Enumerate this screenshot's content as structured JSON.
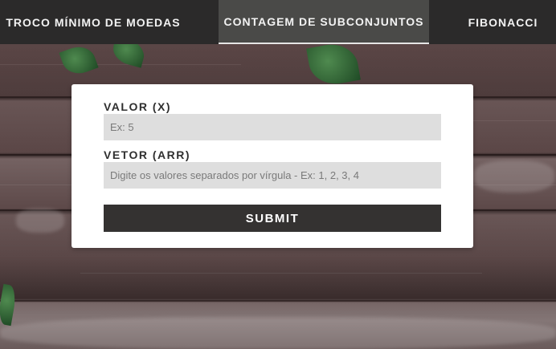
{
  "nav": {
    "items": [
      {
        "label": "TROCO MÍNIMO DE MOEDAS",
        "active": false
      },
      {
        "label": "CONTAGEM DE SUBCONJUNTOS",
        "active": true
      },
      {
        "label": "FIBONACCI",
        "active": false
      }
    ]
  },
  "form": {
    "value_label": "VALOR (X)",
    "value_placeholder": "Ex: 5",
    "vector_label": "VETOR (ARR)",
    "vector_placeholder": "Digite os valores separados por vírgula - Ex: 1, 2, 3, 4",
    "submit_label": "SUBMIT"
  },
  "colors": {
    "nav_bg": "#2b2a2a",
    "nav_active_bg": "#4a4a48",
    "button_bg": "#343231",
    "input_bg": "#dedede"
  }
}
